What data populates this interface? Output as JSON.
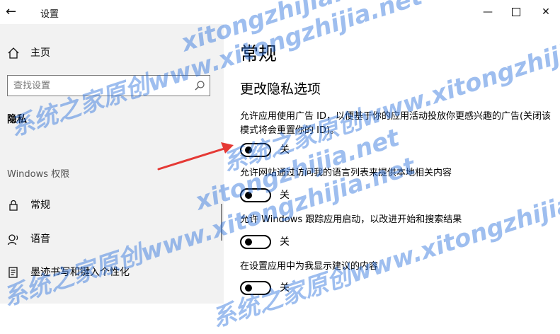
{
  "window": {
    "title": "设置",
    "back_glyph": "←",
    "minimize_glyph": "—",
    "close_glyph": "✕"
  },
  "sidebar": {
    "home_label": "主页",
    "search_placeholder": "查找设置",
    "section_title": "隐私",
    "group_header": "Windows 权限",
    "items": [
      {
        "label": "常规",
        "icon": "lock-icon"
      },
      {
        "label": "语音",
        "icon": "speech-icon"
      },
      {
        "label": "墨迹书写和键入个性化",
        "icon": "ink-typing-icon"
      }
    ]
  },
  "main": {
    "page_title": "常规",
    "subheading": "更改隐私选项",
    "settings": [
      {
        "description": "允许应用使用广告 ID，以便基于你的应用活动投放你更感兴趣的广告(关闭该模式将会重置你的 ID)。",
        "state": "关"
      },
      {
        "description": "允许网站通过访问我的语言列表来提供本地相关内容",
        "state": "关"
      },
      {
        "description": "允许 Windows 跟踪应用启动，以改进开始和搜索结果",
        "state": "关"
      },
      {
        "description": "在设置应用中为我显示建议的内容",
        "state": "关"
      }
    ]
  },
  "watermark": {
    "text": "系统之家原创www.xitongzhijia.net",
    "short_text": "xitongzhijia.net"
  },
  "colors": {
    "sidebar_bg": "#f2f2f2",
    "annotation_arrow": "#e53935",
    "watermark": "#286edc"
  }
}
